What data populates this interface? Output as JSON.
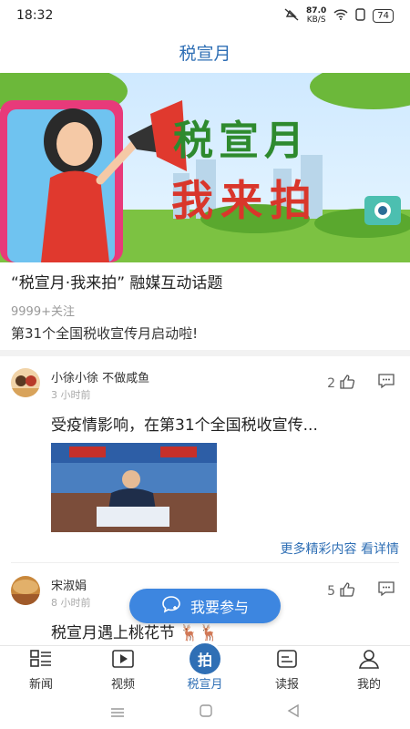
{
  "status": {
    "time": "18:32",
    "speed_value": "87.0",
    "speed_unit": "KB/S",
    "battery": "74"
  },
  "header": {
    "title": "税宣月"
  },
  "banner": {
    "line1": "税宣月",
    "line2": "我来拍"
  },
  "topic": {
    "title": "“税宣月·我来拍” 融媒互动话题",
    "followers": "9999+关注",
    "description": "第31个全国税收宣传月启动啦!"
  },
  "posts": [
    {
      "user": "小徐小徐  不做咸鱼",
      "time": "3 小时前",
      "likes": "2",
      "text": "受疫情影响，在第31个全国税收宣传...",
      "more_label": "更多精彩内容 看详情"
    },
    {
      "user": "宋淑娟",
      "time": "8 小时前",
      "likes": "5",
      "text": "税宣月遇上桃花节"
    }
  ],
  "join_button": {
    "label": "我要参与"
  },
  "tabs": [
    {
      "label": "新闻",
      "icon": "news-icon"
    },
    {
      "label": "视频",
      "icon": "video-icon"
    },
    {
      "label": "税宣月",
      "icon": "photo-icon",
      "badge": "拍",
      "active": true
    },
    {
      "label": "读报",
      "icon": "newspaper-icon"
    },
    {
      "label": "我的",
      "icon": "profile-icon"
    }
  ],
  "colors": {
    "accent": "#2f6fb5",
    "button": "#3d86e0",
    "banner_green": "#2e8a2e",
    "banner_red": "#d9362b"
  }
}
